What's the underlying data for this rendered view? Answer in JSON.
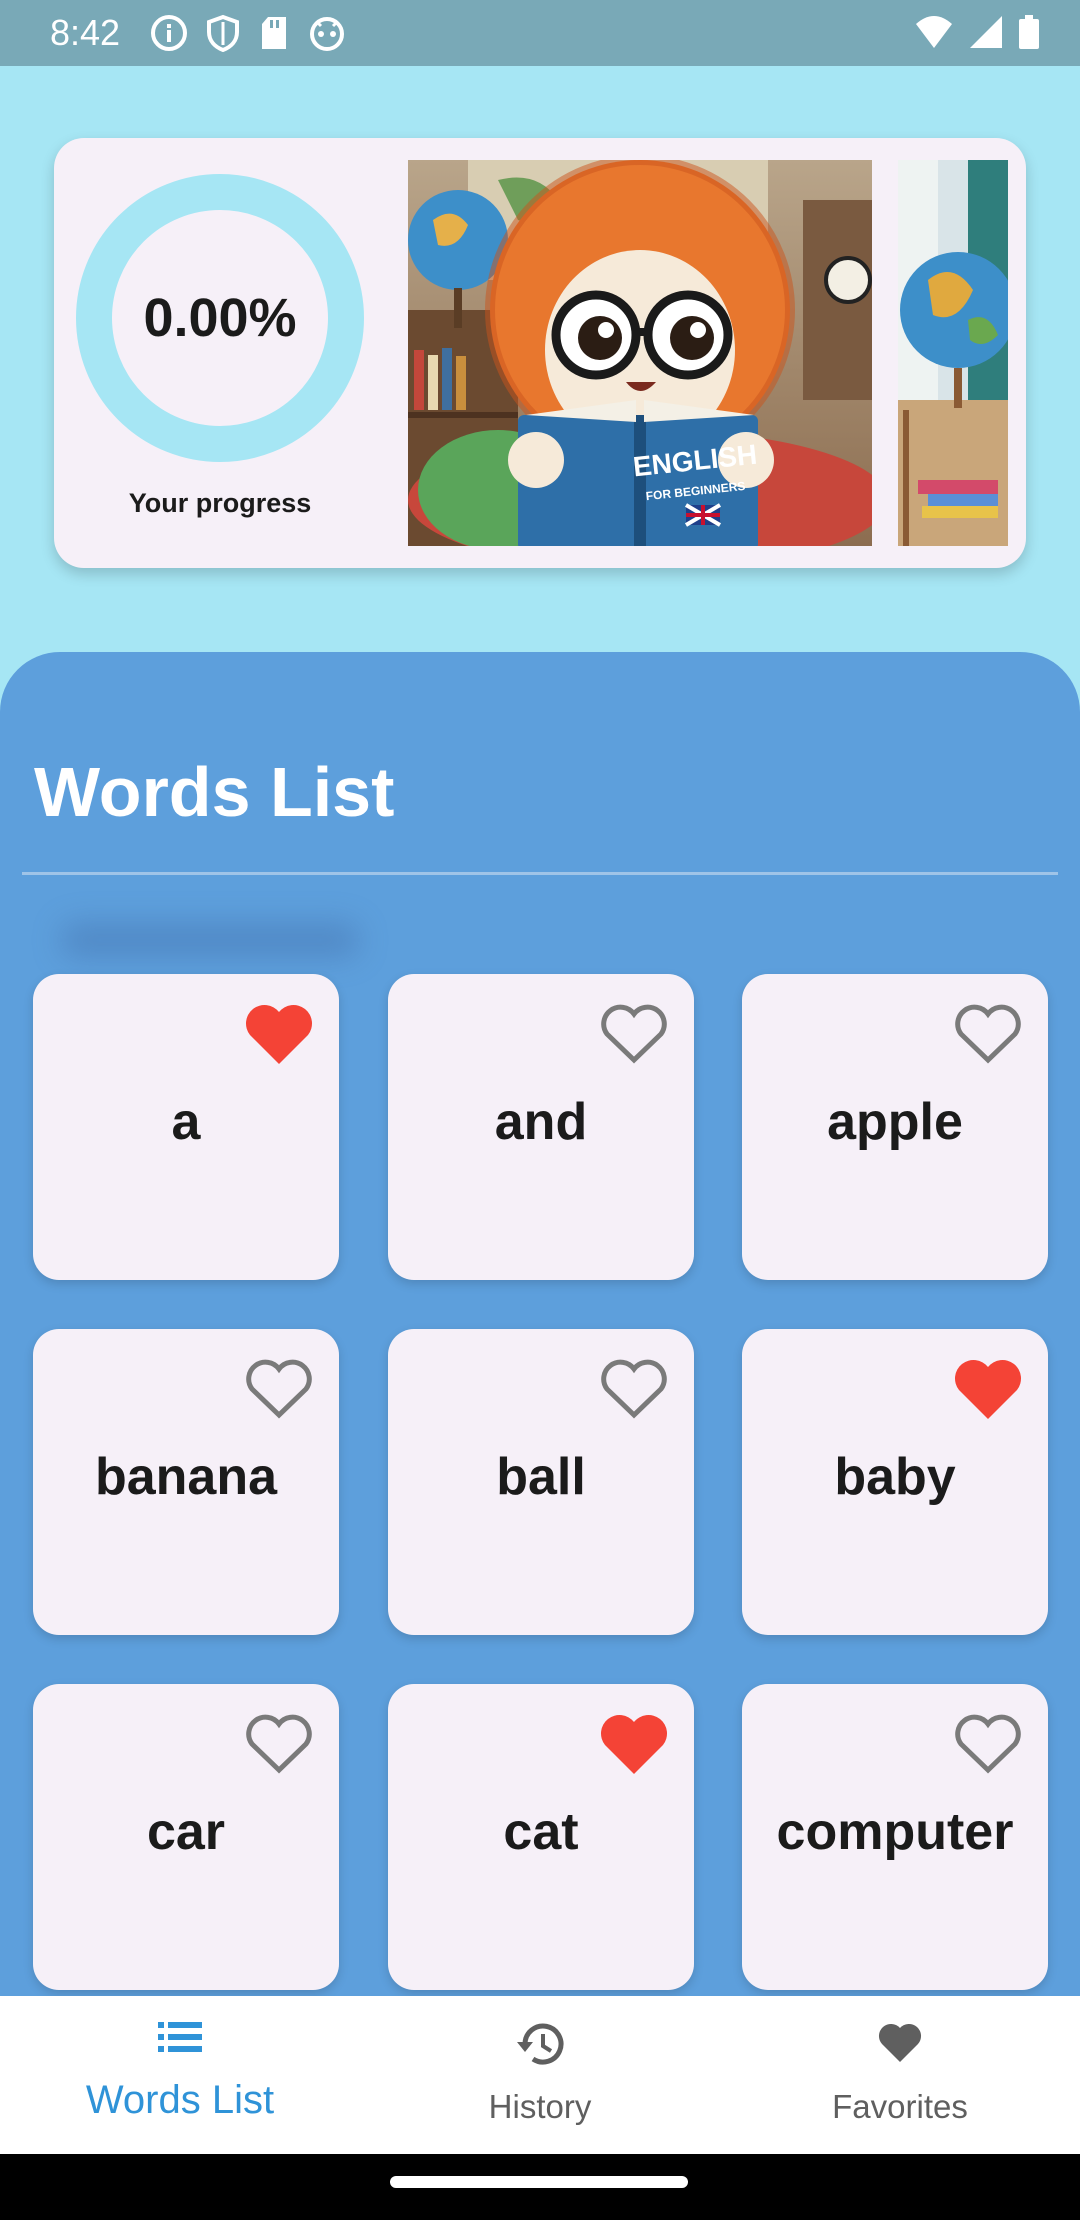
{
  "status_bar": {
    "time": "8:42",
    "left_icons": [
      "info-icon",
      "shield-icon",
      "sd-card-icon",
      "android-face-icon"
    ],
    "right_icons": [
      "wifi-icon",
      "signal-icon",
      "battery-icon"
    ]
  },
  "progress": {
    "value_text": "0.00%",
    "value": 0.0,
    "label": "Your progress",
    "ring_color": "#a6e6f4"
  },
  "carousel": {
    "images": [
      "illustration-character-reading-english-book",
      "illustration-globe-classroom"
    ],
    "book_title": "ENGLISH",
    "book_subtitle": "FOR BEGINNERS"
  },
  "words_section": {
    "title": "Words List",
    "cards": [
      {
        "word": "a",
        "favorite": true
      },
      {
        "word": "and",
        "favorite": false
      },
      {
        "word": "apple",
        "favorite": false
      },
      {
        "word": "banana",
        "favorite": false
      },
      {
        "word": "ball",
        "favorite": false
      },
      {
        "word": "baby",
        "favorite": true
      },
      {
        "word": "car",
        "favorite": false
      },
      {
        "word": "cat",
        "favorite": true
      },
      {
        "word": "computer",
        "favorite": false
      }
    ]
  },
  "bottom_nav": {
    "items": [
      {
        "label": "Words List",
        "icon": "list-icon",
        "active": true
      },
      {
        "label": "History",
        "icon": "history-icon",
        "active": false
      },
      {
        "label": "Favorites",
        "icon": "heart-icon",
        "active": false
      }
    ]
  },
  "colors": {
    "background": "#a6e6f4",
    "panel": "#5d9fdc",
    "card": "#f6f0f8",
    "favorite": "#f44336",
    "heart_outline": "#7a7a7a",
    "active_tab": "#2f93d8"
  }
}
